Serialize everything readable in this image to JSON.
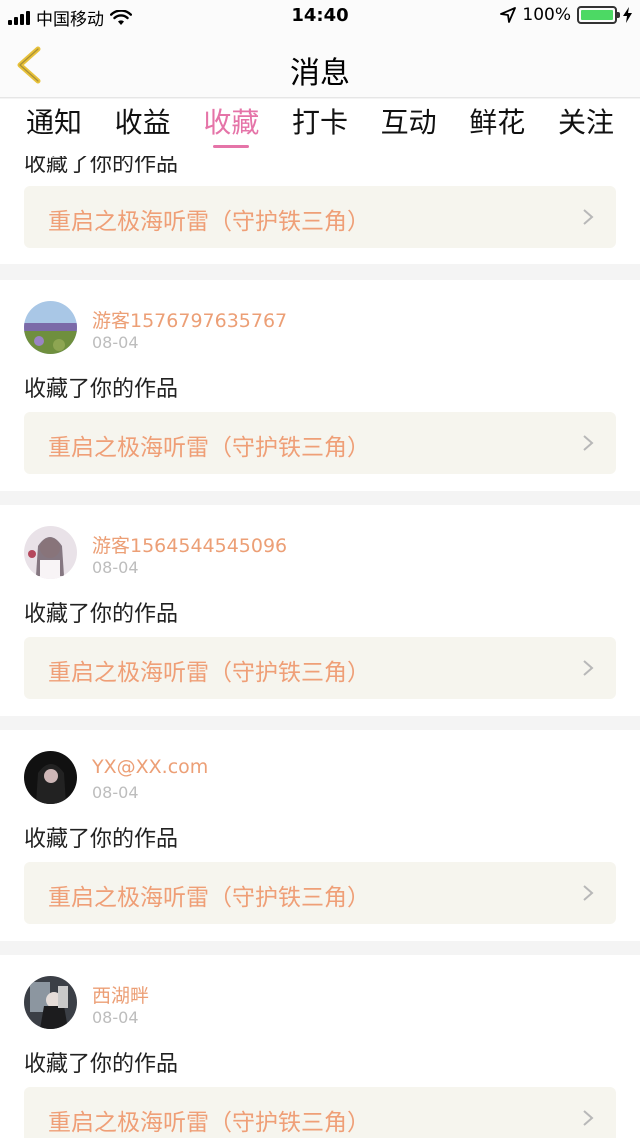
{
  "status_bar": {
    "carrier": "中国移动",
    "time": "14:40",
    "battery": "100%"
  },
  "nav": {
    "title": "消息"
  },
  "tabs": [
    {
      "label": "通知"
    },
    {
      "label": "收益"
    },
    {
      "label": "收藏",
      "active": true
    },
    {
      "label": "打卡"
    },
    {
      "label": "互动"
    },
    {
      "label": "鲜花"
    },
    {
      "label": "关注"
    }
  ],
  "feed": {
    "partial_item": {
      "action": "收藏了你的作品",
      "work_title": "重启之极海听雷（守护铁三角）"
    },
    "items": [
      {
        "username": "游客1576797635767",
        "date": "08-04",
        "action": "收藏了你的作品",
        "work_title": "重启之极海听雷（守护铁三角）"
      },
      {
        "username": "游客1564544545096",
        "date": "08-04",
        "action": "收藏了你的作品",
        "work_title": "重启之极海听雷（守护铁三角）"
      },
      {
        "username": "YX@XX.com",
        "date": "08-04",
        "action": "收藏了你的作品",
        "work_title": "重启之极海听雷（守护铁三角）"
      },
      {
        "username": "西湖畔",
        "date": "08-04",
        "action": "收藏了你的作品",
        "work_title": "重启之极海听雷（守护铁三角）"
      }
    ]
  },
  "colors": {
    "accent_tab": "#e574a8",
    "username": "#ec9f76",
    "work_title": "#ef9f77",
    "battery": "#4cd964",
    "back_arrow": "#e7c13a"
  }
}
